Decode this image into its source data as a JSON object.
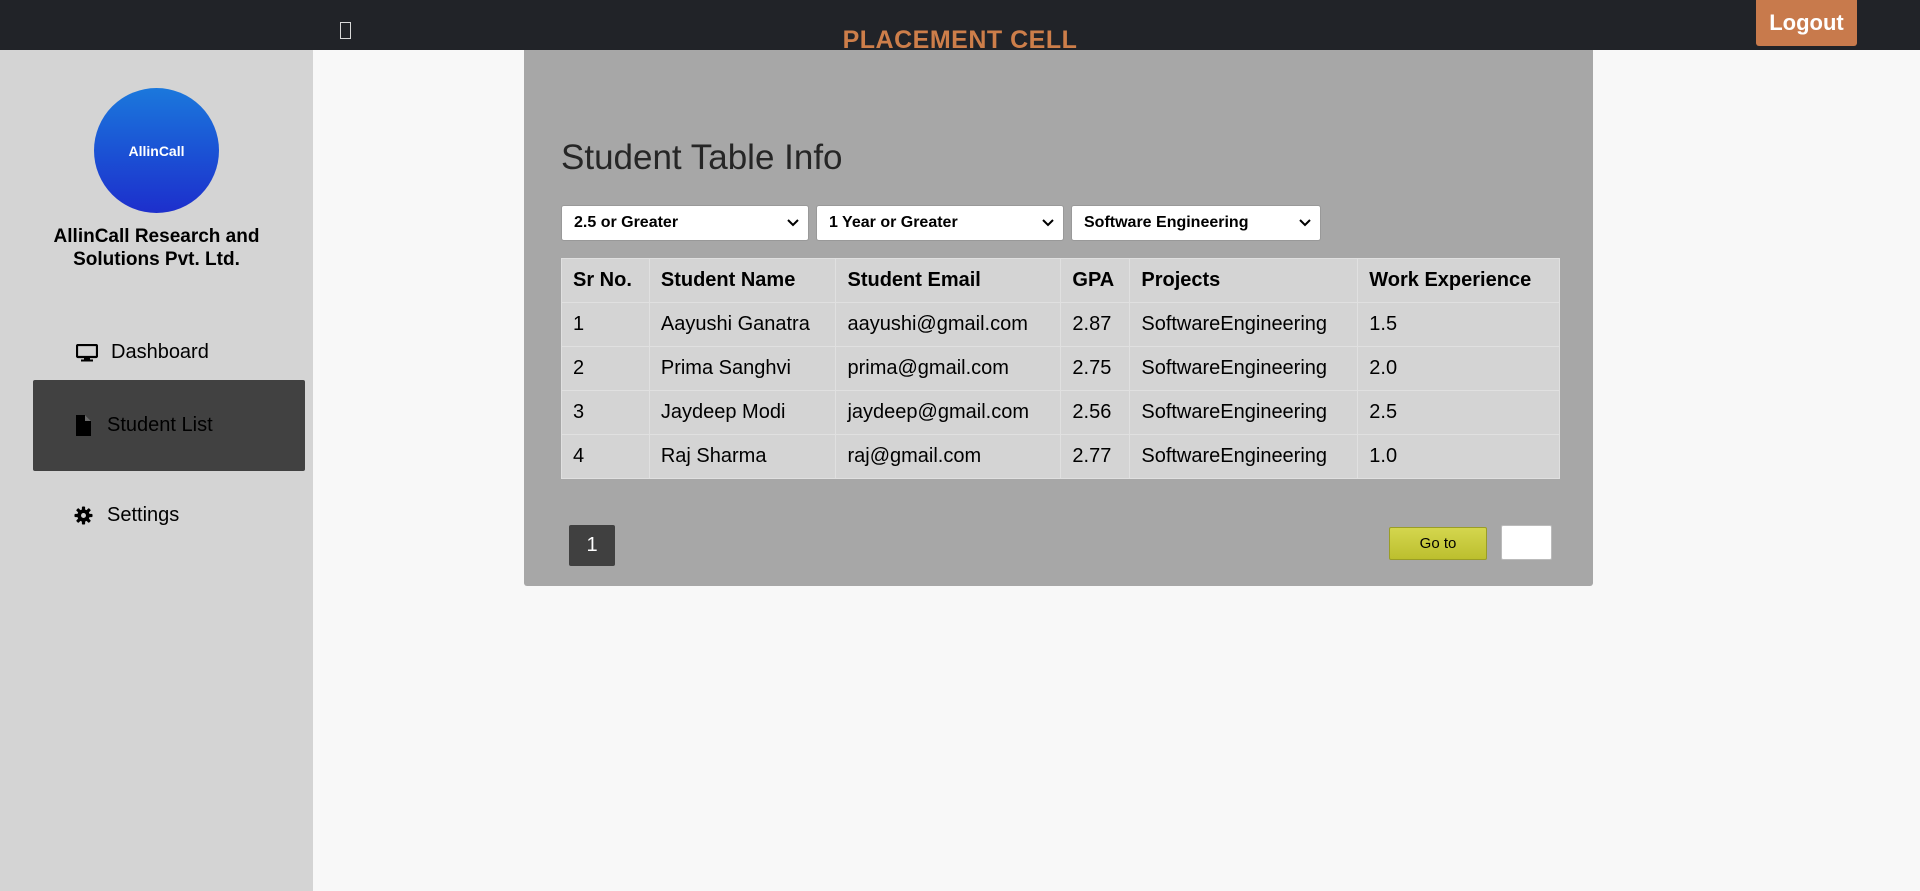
{
  "header": {
    "brand": "PLACEMENT CELL",
    "logout_label": "Logout"
  },
  "sidebar": {
    "logo_text": "AllinCall",
    "company_name": "AllinCall Research and Solutions Pvt. Ltd.",
    "items": [
      {
        "label": "Dashboard",
        "icon": "monitor-icon",
        "active": false
      },
      {
        "label": "Student List",
        "icon": "file-icon",
        "active": true
      },
      {
        "label": "Settings",
        "icon": "gear-icon",
        "active": false
      }
    ]
  },
  "main": {
    "title": "Student Table Info",
    "filters": {
      "gpa": "2.5 or Greater",
      "experience": "1 Year or Greater",
      "project": "Software Engineering"
    },
    "table": {
      "columns": [
        "Sr No.",
        "Student Name",
        "Student Email",
        "GPA",
        "Projects",
        "Work Experience"
      ],
      "rows": [
        [
          "1",
          "Aayushi Ganatra",
          "aayushi@gmail.com",
          "2.87",
          "SoftwareEngineering",
          "1.5"
        ],
        [
          "2",
          "Prima Sanghvi",
          "prima@gmail.com",
          "2.75",
          "SoftwareEngineering",
          "2.0"
        ],
        [
          "3",
          "Jaydeep Modi",
          "jaydeep@gmail.com",
          "2.56",
          "SoftwareEngineering",
          "2.5"
        ],
        [
          "4",
          "Raj Sharma",
          "raj@gmail.com",
          "2.77",
          "SoftwareEngineering",
          "1.0"
        ]
      ]
    },
    "pagination": {
      "current_page": "1",
      "goto_label": "Go to",
      "goto_value": ""
    }
  },
  "colors": {
    "topbar": "#212328",
    "brand": "#cd7e4a",
    "logout": "#c87a4c",
    "sidebar": "#d4d4d4",
    "active_nav": "#414141",
    "panel": "#a7a7a7",
    "goto_button": "#c9cb3d"
  }
}
